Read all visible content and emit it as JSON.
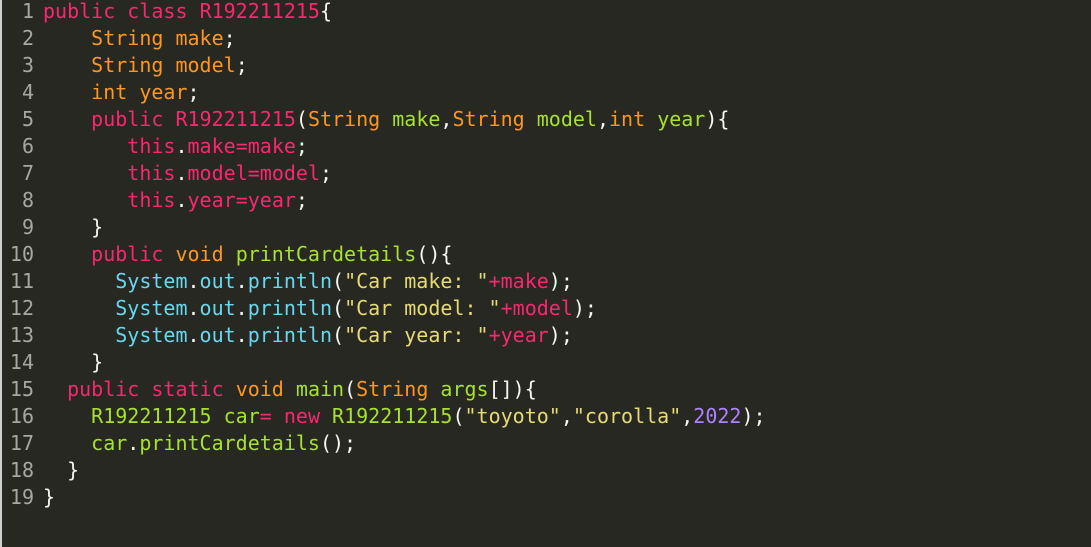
{
  "colors": {
    "background": "#272822",
    "line_number": "#a8a8a0",
    "keyword": "#f92672",
    "type": "#fd971f",
    "identifier": "#a6e22e",
    "string": "#e6db74",
    "number": "#ae81ff",
    "builtin": "#66d9ef",
    "punctuation": "#f8f8f2"
  },
  "editor": {
    "lines": [
      {
        "no": "1",
        "indent": "",
        "tokens": [
          {
            "t": "public",
            "c": "k"
          },
          {
            "t": " ",
            "c": "p"
          },
          {
            "t": "class",
            "c": "k"
          },
          {
            "t": " ",
            "c": "p"
          },
          {
            "t": "R192211215",
            "c": "k"
          },
          {
            "t": "{",
            "c": "p"
          }
        ]
      },
      {
        "no": "2",
        "indent": "    ",
        "tokens": [
          {
            "t": "String",
            "c": "t"
          },
          {
            "t": " ",
            "c": "p"
          },
          {
            "t": "make",
            "c": "t"
          },
          {
            "t": ";",
            "c": "p"
          }
        ]
      },
      {
        "no": "3",
        "indent": "    ",
        "tokens": [
          {
            "t": "String",
            "c": "t"
          },
          {
            "t": " ",
            "c": "p"
          },
          {
            "t": "model",
            "c": "t"
          },
          {
            "t": ";",
            "c": "p"
          }
        ]
      },
      {
        "no": "4",
        "indent": "    ",
        "tokens": [
          {
            "t": "int",
            "c": "t"
          },
          {
            "t": " ",
            "c": "p"
          },
          {
            "t": "year",
            "c": "t"
          },
          {
            "t": ";",
            "c": "p"
          }
        ]
      },
      {
        "no": "5",
        "indent": "    ",
        "tokens": [
          {
            "t": "public",
            "c": "k"
          },
          {
            "t": " ",
            "c": "p"
          },
          {
            "t": "R192211215",
            "c": "k"
          },
          {
            "t": "(",
            "c": "p"
          },
          {
            "t": "String",
            "c": "t"
          },
          {
            "t": " ",
            "c": "p"
          },
          {
            "t": "make",
            "c": "f"
          },
          {
            "t": ",",
            "c": "p"
          },
          {
            "t": "String",
            "c": "t"
          },
          {
            "t": " ",
            "c": "p"
          },
          {
            "t": "model",
            "c": "f"
          },
          {
            "t": ",",
            "c": "p"
          },
          {
            "t": "int",
            "c": "t"
          },
          {
            "t": " ",
            "c": "p"
          },
          {
            "t": "year",
            "c": "f"
          },
          {
            "t": "){",
            "c": "p"
          }
        ]
      },
      {
        "no": "6",
        "indent": "       ",
        "tokens": [
          {
            "t": "this",
            "c": "k"
          },
          {
            "t": ".",
            "c": "p"
          },
          {
            "t": "make",
            "c": "k"
          },
          {
            "t": "=",
            "c": "k"
          },
          {
            "t": "make",
            "c": "k"
          },
          {
            "t": ";",
            "c": "p"
          }
        ]
      },
      {
        "no": "7",
        "indent": "       ",
        "tokens": [
          {
            "t": "this",
            "c": "k"
          },
          {
            "t": ".",
            "c": "p"
          },
          {
            "t": "model",
            "c": "k"
          },
          {
            "t": "=",
            "c": "k"
          },
          {
            "t": "model",
            "c": "k"
          },
          {
            "t": ";",
            "c": "p"
          }
        ]
      },
      {
        "no": "8",
        "indent": "       ",
        "tokens": [
          {
            "t": "this",
            "c": "k"
          },
          {
            "t": ".",
            "c": "p"
          },
          {
            "t": "year",
            "c": "k"
          },
          {
            "t": "=",
            "c": "k"
          },
          {
            "t": "year",
            "c": "k"
          },
          {
            "t": ";",
            "c": "p"
          }
        ]
      },
      {
        "no": "9",
        "indent": "    ",
        "tokens": [
          {
            "t": "}",
            "c": "p"
          }
        ]
      },
      {
        "no": "10",
        "indent": "    ",
        "tokens": [
          {
            "t": "public",
            "c": "k"
          },
          {
            "t": " ",
            "c": "p"
          },
          {
            "t": "void",
            "c": "t"
          },
          {
            "t": " ",
            "c": "p"
          },
          {
            "t": "printCardetails",
            "c": "f"
          },
          {
            "t": "(){",
            "c": "p"
          }
        ]
      },
      {
        "no": "11",
        "indent": "      ",
        "tokens": [
          {
            "t": "System",
            "c": "c"
          },
          {
            "t": ".",
            "c": "p"
          },
          {
            "t": "out",
            "c": "c"
          },
          {
            "t": ".",
            "c": "p"
          },
          {
            "t": "println",
            "c": "c"
          },
          {
            "t": "(",
            "c": "p"
          },
          {
            "t": "\"Car make: \"",
            "c": "s"
          },
          {
            "t": "+",
            "c": "k"
          },
          {
            "t": "make",
            "c": "k"
          },
          {
            "t": ");",
            "c": "p"
          }
        ]
      },
      {
        "no": "12",
        "indent": "      ",
        "tokens": [
          {
            "t": "System",
            "c": "c"
          },
          {
            "t": ".",
            "c": "p"
          },
          {
            "t": "out",
            "c": "c"
          },
          {
            "t": ".",
            "c": "p"
          },
          {
            "t": "println",
            "c": "c"
          },
          {
            "t": "(",
            "c": "p"
          },
          {
            "t": "\"Car model: \"",
            "c": "s"
          },
          {
            "t": "+",
            "c": "k"
          },
          {
            "t": "model",
            "c": "k"
          },
          {
            "t": ");",
            "c": "p"
          }
        ]
      },
      {
        "no": "13",
        "indent": "      ",
        "tokens": [
          {
            "t": "System",
            "c": "c"
          },
          {
            "t": ".",
            "c": "p"
          },
          {
            "t": "out",
            "c": "c"
          },
          {
            "t": ".",
            "c": "p"
          },
          {
            "t": "println",
            "c": "c"
          },
          {
            "t": "(",
            "c": "p"
          },
          {
            "t": "\"Car year: \"",
            "c": "s"
          },
          {
            "t": "+",
            "c": "k"
          },
          {
            "t": "year",
            "c": "k"
          },
          {
            "t": ");",
            "c": "p"
          }
        ]
      },
      {
        "no": "14",
        "indent": "    ",
        "tokens": [
          {
            "t": "}",
            "c": "p"
          }
        ]
      },
      {
        "no": "15",
        "indent": "  ",
        "tokens": [
          {
            "t": "public",
            "c": "k"
          },
          {
            "t": " ",
            "c": "p"
          },
          {
            "t": "static",
            "c": "k"
          },
          {
            "t": " ",
            "c": "p"
          },
          {
            "t": "void",
            "c": "t"
          },
          {
            "t": " ",
            "c": "p"
          },
          {
            "t": "main",
            "c": "f"
          },
          {
            "t": "(",
            "c": "p"
          },
          {
            "t": "String",
            "c": "t"
          },
          {
            "t": " ",
            "c": "p"
          },
          {
            "t": "args",
            "c": "f"
          },
          {
            "t": "[]){",
            "c": "p"
          }
        ]
      },
      {
        "no": "16",
        "indent": "    ",
        "tokens": [
          {
            "t": "R192211215",
            "c": "f"
          },
          {
            "t": " ",
            "c": "p"
          },
          {
            "t": "car",
            "c": "f"
          },
          {
            "t": "=",
            "c": "k"
          },
          {
            "t": " ",
            "c": "p"
          },
          {
            "t": "new",
            "c": "k"
          },
          {
            "t": " ",
            "c": "p"
          },
          {
            "t": "R192211215",
            "c": "f"
          },
          {
            "t": "(",
            "c": "p"
          },
          {
            "t": "\"toyoto\"",
            "c": "s"
          },
          {
            "t": ",",
            "c": "p"
          },
          {
            "t": "\"corolla\"",
            "c": "s"
          },
          {
            "t": ",",
            "c": "p"
          },
          {
            "t": "2022",
            "c": "n"
          },
          {
            "t": ");",
            "c": "p"
          }
        ]
      },
      {
        "no": "17",
        "indent": "    ",
        "tokens": [
          {
            "t": "car",
            "c": "f"
          },
          {
            "t": ".",
            "c": "p"
          },
          {
            "t": "printCardetails",
            "c": "f"
          },
          {
            "t": "();",
            "c": "p"
          }
        ]
      },
      {
        "no": "18",
        "indent": "  ",
        "tokens": [
          {
            "t": "}",
            "c": "p"
          }
        ]
      },
      {
        "no": "19",
        "indent": "",
        "tokens": [
          {
            "t": "}",
            "c": "p"
          }
        ]
      }
    ]
  }
}
